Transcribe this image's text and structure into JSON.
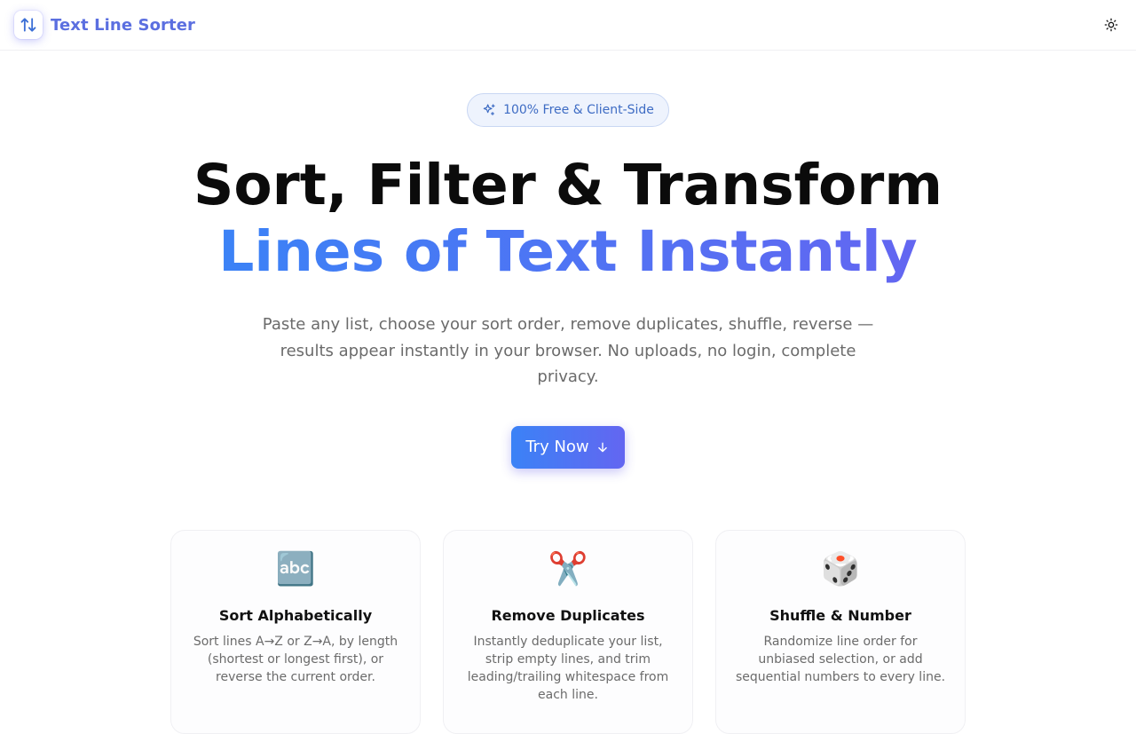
{
  "header": {
    "brand_name": "Text Line Sorter"
  },
  "hero": {
    "badge_text": "100% Free & Client-Side",
    "title_line1": "Sort, Filter & Transform",
    "title_line2": "Lines of Text Instantly",
    "subtitle": "Paste any list, choose your sort order, remove duplicates, shuffle, reverse — results appear instantly in your browser. No uploads, no login, complete privacy.",
    "cta_label": "Try Now"
  },
  "features": [
    {
      "icon": "🔤",
      "title": "Sort Alphabetically",
      "description": "Sort lines A→Z or Z→A, by length (shortest or longest first), or reverse the current order."
    },
    {
      "icon": "✂️",
      "title": "Remove Duplicates",
      "description": "Instantly deduplicate your list, strip empty lines, and trim leading/trailing whitespace from each line."
    },
    {
      "icon": "🎲",
      "title": "Shuffle & Number",
      "description": "Randomize line order for unbiased selection, or add sequential numbers to every line."
    }
  ],
  "colors": {
    "accent_start": "#3b82f6",
    "accent_end": "#6366f1",
    "brand_text": "#5b6fe0",
    "badge_bg": "#eef3fd",
    "badge_text": "#3e6cc4"
  },
  "icons": {
    "logo": "sort-arrows-icon",
    "theme_toggle": "sun-icon",
    "badge": "sparkles-icon",
    "cta": "arrow-down-icon"
  }
}
